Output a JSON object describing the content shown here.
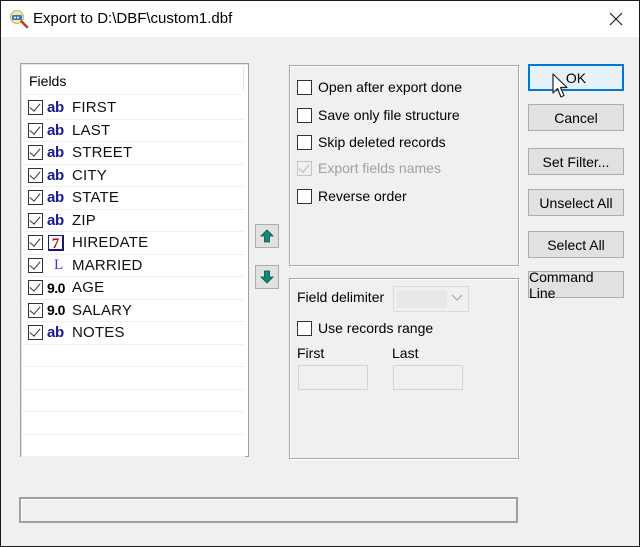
{
  "window": {
    "title": "Export to D:\\DBF\\custom1.dbf",
    "icon": "export-magnifier-icon",
    "close_icon": "close-icon"
  },
  "fields_list": {
    "header": "Fields",
    "items": [
      {
        "name": "FIRST",
        "type": "character",
        "type_badge": "ab",
        "checked": true
      },
      {
        "name": "LAST",
        "type": "character",
        "type_badge": "ab",
        "checked": true
      },
      {
        "name": "STREET",
        "type": "character",
        "type_badge": "ab",
        "checked": true
      },
      {
        "name": "CITY",
        "type": "character",
        "type_badge": "ab",
        "checked": true
      },
      {
        "name": "STATE",
        "type": "character",
        "type_badge": "ab",
        "checked": true
      },
      {
        "name": "ZIP",
        "type": "character",
        "type_badge": "ab",
        "checked": true
      },
      {
        "name": "HIREDATE",
        "type": "date",
        "type_badge": "7",
        "checked": true
      },
      {
        "name": "MARRIED",
        "type": "logical",
        "type_badge": "L",
        "checked": true
      },
      {
        "name": "AGE",
        "type": "numeric",
        "type_badge": "9.0",
        "checked": true
      },
      {
        "name": "SALARY",
        "type": "numeric",
        "type_badge": "9.0",
        "checked": true
      },
      {
        "name": "NOTES",
        "type": "memo",
        "type_badge": "ab",
        "checked": true
      }
    ]
  },
  "move_buttons": {
    "up_icon": "arrow-up-icon",
    "down_icon": "arrow-down-icon"
  },
  "options": [
    {
      "label": "Open after export done",
      "checked": false,
      "enabled": true
    },
    {
      "label": "Save only file structure",
      "checked": false,
      "enabled": true
    },
    {
      "label": "Skip deleted records",
      "checked": false,
      "enabled": true
    },
    {
      "label": "Export fields names",
      "checked": true,
      "enabled": false
    },
    {
      "label": "Reverse order",
      "checked": false,
      "enabled": true
    }
  ],
  "params": {
    "field_delimiter_label": "Field delimiter",
    "field_delimiter_value": "",
    "use_range_label": "Use records range",
    "use_range_checked": false,
    "first_label": "First",
    "first_value": "",
    "last_label": "Last",
    "last_value": ""
  },
  "buttons": {
    "ok": "OK",
    "cancel": "Cancel",
    "set_filter": "Set Filter...",
    "unselect_all": "Unselect All",
    "select_all": "Select All",
    "command_line": "Command Line"
  },
  "progress": {
    "value_percent": 0
  },
  "colors": {
    "default_button_border": "#0078d7",
    "type_char": "#1a1a8c",
    "type_date": "#b01010",
    "type_logical": "#3a3adc",
    "arrow_teal": "#0e7a6e"
  }
}
